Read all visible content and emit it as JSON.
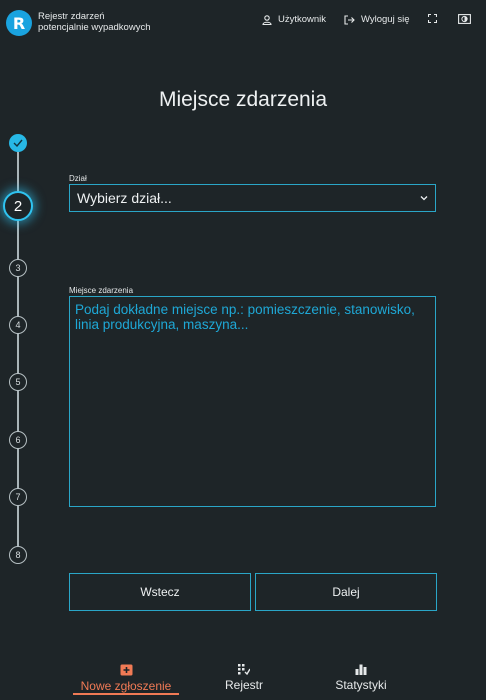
{
  "header": {
    "logo_letter": "R",
    "app_title_line1": "Rejestr zdarzeń",
    "app_title_line2": "potencjalnie wypadkowych",
    "user_label": "Użytkownik",
    "logout_label": "Wyloguj się"
  },
  "page_title": "Miejsce zdarzenia",
  "stepper": {
    "current": "2",
    "steps": [
      "3",
      "4",
      "5",
      "6",
      "7",
      "8"
    ]
  },
  "form": {
    "department_label": "Dział",
    "department_value": "Wybierz dział...",
    "place_label": "Miejsce zdarzenia",
    "place_placeholder": "Podaj dokładne miejsce np.: pomieszczenie, stanowisko, linia produkcyjna, maszyna..."
  },
  "buttons": {
    "back": "Wstecz",
    "next": "Dalej"
  },
  "nav": {
    "new_report": "Nowe zgłoszenie",
    "register": "Rejestr",
    "stats": "Statystyki"
  },
  "colors": {
    "accent": "#2aa6c7",
    "nav_active": "#f07a55",
    "background": "#1e2528"
  }
}
